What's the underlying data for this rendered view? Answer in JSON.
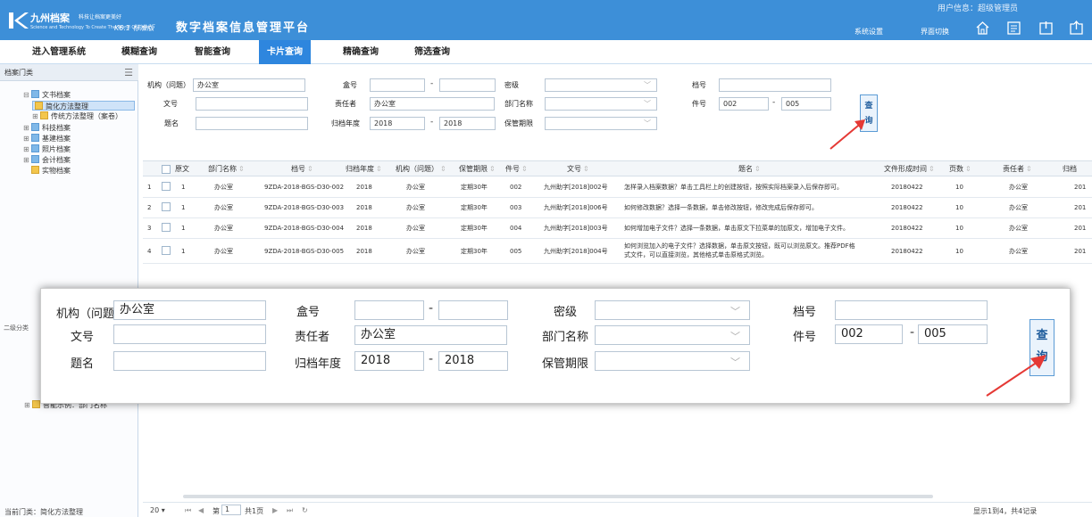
{
  "header": {
    "logo_title": "九州档案",
    "logo_tagline": "科技让档案更美好",
    "logo_subtitle": "Science and Technology To Create The World Of Order",
    "version": "K6.1 标准版",
    "app_title": "数字档案信息管理平台",
    "user_info": "用户信息：超级管理员",
    "link_settings": "系统设置",
    "link_switch": "界面切换"
  },
  "nav": {
    "items": [
      "进入管理系统",
      "模糊查询",
      "智能查询",
      "卡片查询",
      "精确查询",
      "筛选查询"
    ],
    "active": "卡片查询"
  },
  "sidebar": {
    "title": "档案门类",
    "tree": [
      "文书档案",
      "简化方法整理",
      "传统方法整理（案卷）",
      "科技档案",
      "基建档案",
      "照片档案",
      "会计档案",
      "实物档案"
    ],
    "second_title": "二级分类",
    "second_item": "智能示例：部门名称",
    "current": "当前门类：简化方法整理"
  },
  "form": {
    "org_label": "机构（问题）",
    "org_value": "办公室",
    "box_label": "盒号",
    "secret_label": "密级",
    "file_no_label": "档号",
    "doc_no_label": "文号",
    "owner_label": "责任者",
    "owner_value": "办公室",
    "dept_label": "部门名称",
    "item_no_label": "件号",
    "item_from": "002",
    "item_to": "005",
    "title_label": "题名",
    "year_label": "归档年度",
    "year_from": "2018",
    "year_to": "2018",
    "retention_label": "保管期限",
    "query_btn": "查\n询",
    "dash": "-"
  },
  "table": {
    "headers": [
      "原文",
      "部门名称",
      "档号",
      "归档年度",
      "机构（问题）",
      "保管期限",
      "件号",
      "文号",
      "题名",
      "文件形成时间",
      "页数",
      "责任者",
      "归档"
    ],
    "rows": [
      {
        "idx": "1",
        "orig": "1",
        "dept": "办公室",
        "archive_no": "9ZDA-2018-BGS-D30-002",
        "year": "2018",
        "org": "办公室",
        "retention": "定期30年",
        "item": "002",
        "doc_no": "九州助字[2018]002号",
        "title": "怎样录入档案数据？单击工具栏上的创建按钮，按照实际档案录入后保存即可。",
        "date": "20180422",
        "pages": "10",
        "owner": "办公室",
        "cut": "201"
      },
      {
        "idx": "2",
        "orig": "1",
        "dept": "办公室",
        "archive_no": "9ZDA-2018-BGS-D30-003",
        "year": "2018",
        "org": "办公室",
        "retention": "定期30年",
        "item": "003",
        "doc_no": "九州助字[2018]006号",
        "title": "如何修改数据？选择一条数据，单击修改按钮，修改完成后保存即可。",
        "date": "20180422",
        "pages": "10",
        "owner": "办公室",
        "cut": "201"
      },
      {
        "idx": "3",
        "orig": "1",
        "dept": "办公室",
        "archive_no": "9ZDA-2018-BGS-D30-004",
        "year": "2018",
        "org": "办公室",
        "retention": "定期30年",
        "item": "004",
        "doc_no": "九州助字[2018]003号",
        "title": "如何增加电子文件？选择一条数据，单击原文下拉菜单的加原文，增加电子文件。",
        "date": "20180422",
        "pages": "10",
        "owner": "办公室",
        "cut": "201"
      },
      {
        "idx": "4",
        "orig": "1",
        "dept": "办公室",
        "archive_no": "9ZDA-2018-BGS-D30-005",
        "year": "2018",
        "org": "办公室",
        "retention": "定期30年",
        "item": "005",
        "doc_no": "九州助字[2018]004号",
        "title": "如何浏览加入的电子文件？选择数据，单击原文按钮，既可以浏览原文。推荐PDF格",
        "title2": "式文件，可以直接浏览，其他格式单击原格式浏览。",
        "date": "20180422",
        "pages": "10",
        "owner": "办公室",
        "cut": "201"
      }
    ]
  },
  "pager": {
    "page_size": "20",
    "page_label": "第",
    "page_value": "1",
    "total_pages": "共1页",
    "summary": "显示1到4，共4记录"
  },
  "colors": {
    "header": "#3d8fd8",
    "accent": "#2e86de",
    "arrow": "#e53935"
  }
}
